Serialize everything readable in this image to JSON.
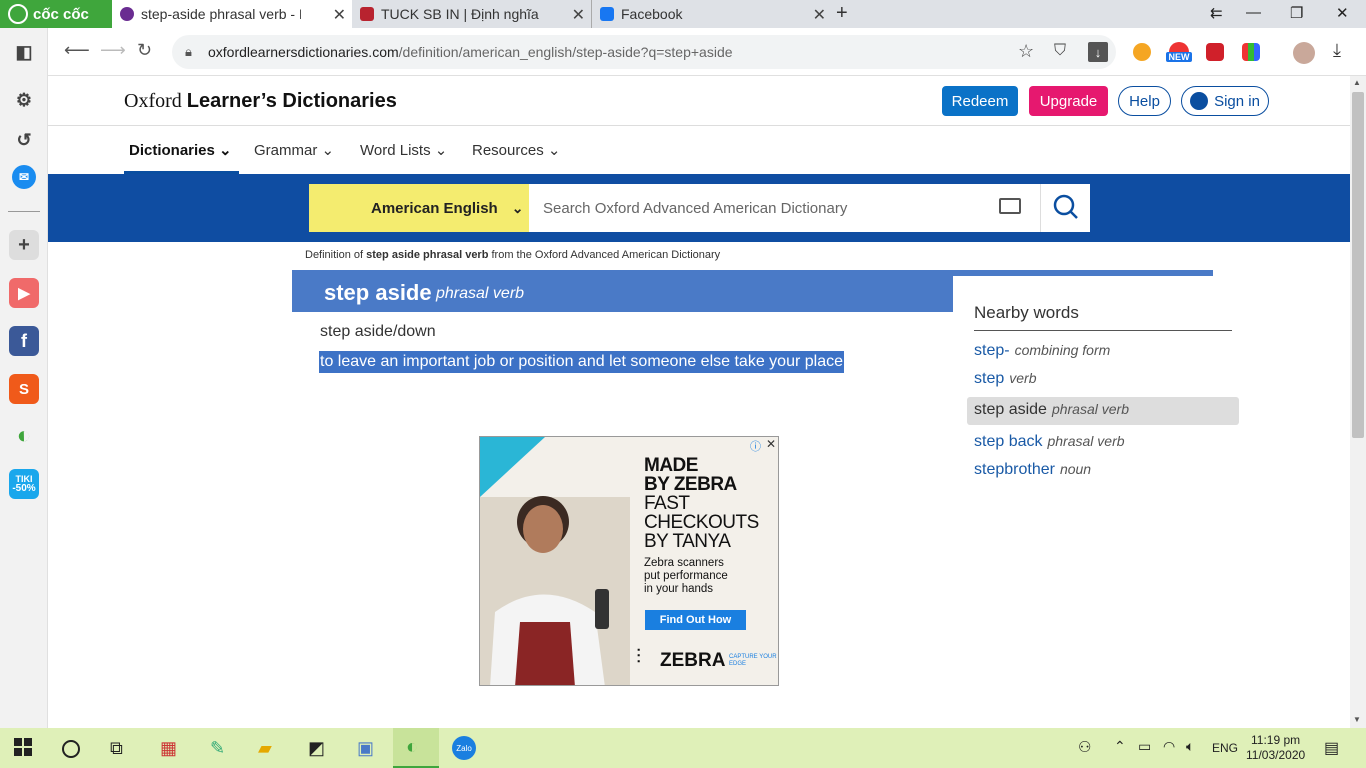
{
  "browser": {
    "brand": "cốc cốc",
    "tabs": [
      {
        "title": "step-aside phrasal verb - Defi",
        "active": true
      },
      {
        "title": "TUCK SB IN | Định nghĩa tron",
        "active": false
      },
      {
        "title": "Facebook",
        "active": false
      }
    ],
    "url_host": "oxfordlearnersdictionaries.com",
    "url_path": "/definition/american_english/step-aside?q=step+aside",
    "new_badge": "NEW"
  },
  "sidebar": {
    "tiki_label": "TIKI",
    "tiki_discount": "-50%"
  },
  "site": {
    "logo_prefix": "Oxford",
    "logo_main": "Learner’s Dictionaries",
    "redeem": "Redeem",
    "upgrade": "Upgrade",
    "help": "Help",
    "sign_in": "Sign in",
    "menu": [
      "Dictionaries",
      "Grammar",
      "Word Lists",
      "Resources"
    ],
    "lang_select": "American English",
    "search_placeholder": "Search Oxford Advanced American Dictionary"
  },
  "entry": {
    "definition_of_prefix": "Definition of",
    "definition_of_term": "step aside phrasal verb",
    "definition_of_suffix": "from the Oxford Advanced American Dictionary",
    "headword": "step aside",
    "pos": "phrasal verb",
    "variant": "step aside/down",
    "sense": "to leave an important job or position and let someone else take your place"
  },
  "nearby": {
    "title": "Nearby words",
    "items": [
      {
        "word": "step-",
        "pos": "combining form",
        "selected": false
      },
      {
        "word": "step",
        "pos": "verb",
        "selected": false
      },
      {
        "word": "step aside",
        "pos": "phrasal verb",
        "selected": true
      },
      {
        "word": "step back",
        "pos": "phrasal verb",
        "selected": false
      },
      {
        "word": "stepbrother",
        "pos": "noun",
        "selected": false
      }
    ]
  },
  "ad": {
    "headline": [
      "MADE",
      "BY ZEBRA",
      "FAST",
      "CHECKOUTS",
      "BY TANYA"
    ],
    "sub": [
      "Zebra scanners",
      "put performance",
      "in your hands"
    ],
    "cta": "Find Out How",
    "brand": "ZEBRA",
    "tagline": "CAPTURE YOUR EDGE"
  },
  "taskbar": {
    "lang": "ENG",
    "time": "11:19 pm",
    "date": "11/03/2020",
    "zalo": "Zalo"
  },
  "colors": {
    "brand_blue": "#0f4da2",
    "entry_blue": "#4a7ac7",
    "upgrade_pink": "#e6186f",
    "redeem_blue": "#0a72c7",
    "lang_yellow": "#f4ec6f"
  }
}
